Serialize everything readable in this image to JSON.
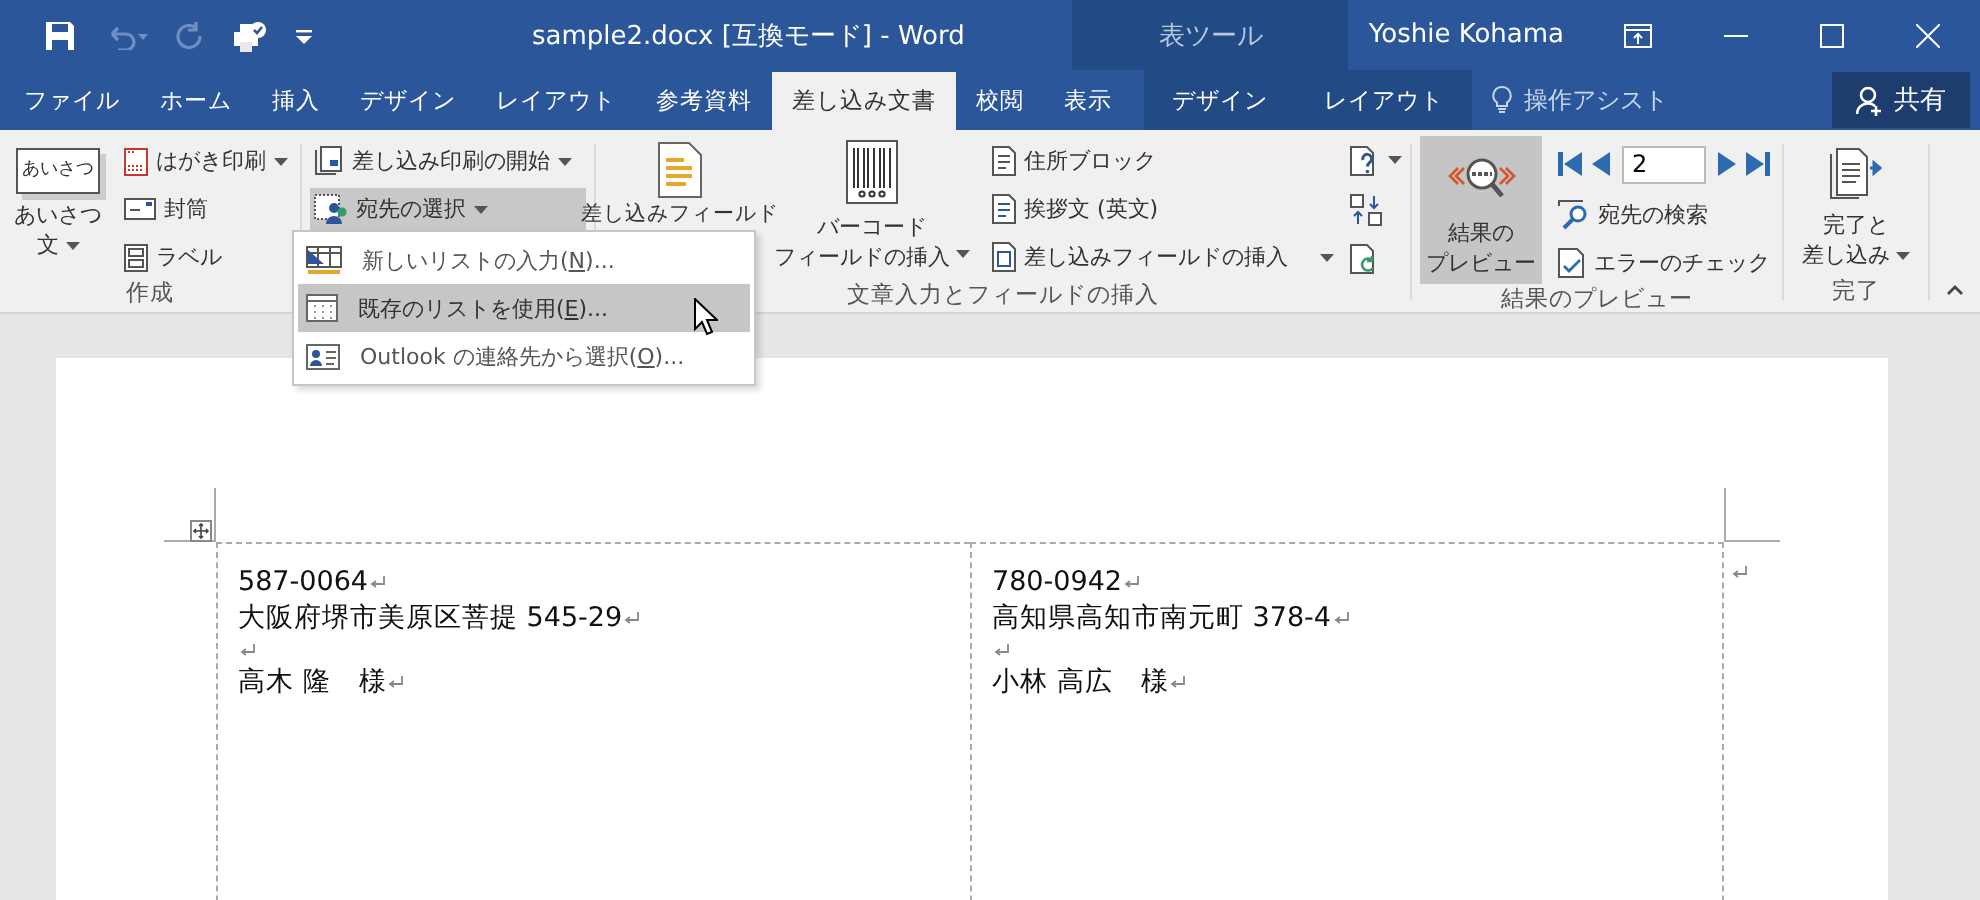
{
  "title_bar": {
    "title": "sample2.docx [互換モード] - Word",
    "contextual_label": "表ツール",
    "user": "Yoshie Kohama"
  },
  "tabs": [
    {
      "label": "ファイル",
      "selected": false,
      "contextual": false
    },
    {
      "label": "ホーム",
      "selected": false,
      "contextual": false
    },
    {
      "label": "挿入",
      "selected": false,
      "contextual": false
    },
    {
      "label": "デザイン",
      "selected": false,
      "contextual": false
    },
    {
      "label": "レイアウト",
      "selected": false,
      "contextual": false
    },
    {
      "label": "参考資料",
      "selected": false,
      "contextual": false
    },
    {
      "label": "差し込み文書",
      "selected": true,
      "contextual": false
    },
    {
      "label": "校閲",
      "selected": false,
      "contextual": false
    },
    {
      "label": "表示",
      "selected": false,
      "contextual": false
    },
    {
      "label": "デザイン",
      "selected": false,
      "contextual": true
    },
    {
      "label": "レイアウト",
      "selected": false,
      "contextual": true
    }
  ],
  "tell_me": "操作アシスト",
  "share": "共有",
  "ribbon": {
    "create": {
      "label": "作成",
      "greeting_icon": "あいさつ",
      "greeting_lines": [
        "あいさつ",
        "文"
      ],
      "small": [
        {
          "label": "はがき印刷",
          "dropdown": true
        },
        {
          "label": "封筒",
          "dropdown": false
        },
        {
          "label": "ラベル",
          "dropdown": false
        }
      ]
    },
    "start": {
      "items": [
        {
          "label": "差し込み印刷の開始",
          "dropdown": true,
          "pressed": false
        },
        {
          "label": "宛先の選択",
          "dropdown": true,
          "pressed": true
        }
      ]
    },
    "insert": {
      "label": "文章入力とフィールドの挿入",
      "merge_field": "差し込みフィールド",
      "barcode_lines": [
        "バーコード",
        "フィールドの挿入"
      ],
      "small": [
        {
          "label": "住所ブロック",
          "dropdown": false
        },
        {
          "label": "挨拶文 (英文)",
          "dropdown": false
        },
        {
          "label": "差し込みフィールドの挿入",
          "dropdown": true
        }
      ]
    },
    "preview": {
      "label": "結果のプレビュー",
      "preview_lines": [
        "結果の",
        "プレビュー"
      ],
      "preview_pressed": true,
      "record": "2",
      "small": [
        {
          "label": "宛先の検索"
        },
        {
          "label": "エラーのチェック"
        }
      ]
    },
    "finish": {
      "label": "完了",
      "lines": [
        "完了と",
        "差し込み"
      ]
    }
  },
  "menu": [
    {
      "before": "新しいリストの入力(",
      "key": "N",
      "after": ")...",
      "selected": false
    },
    {
      "before": "既存のリストを使用(",
      "key": "E",
      "after": ")...",
      "selected": true
    },
    {
      "before": "Outlook の連絡先から選択(",
      "key": "O",
      "after": ")...",
      "selected": false
    }
  ],
  "document": {
    "cells": [
      {
        "paragraphs": [
          {
            "kind": "text",
            "text": "587-0064"
          },
          {
            "kind": "text",
            "text": "大阪府堺市美原区菩提 545-29"
          },
          {
            "kind": "empty"
          },
          {
            "kind": "text",
            "text": "高木 隆　様"
          }
        ]
      },
      {
        "paragraphs": [
          {
            "kind": "text",
            "text": "780-0942"
          },
          {
            "kind": "text",
            "text": "高知県高知市南元町 378-4"
          },
          {
            "kind": "empty"
          },
          {
            "kind": "text",
            "text": "小林 高広　様"
          }
        ]
      }
    ]
  }
}
